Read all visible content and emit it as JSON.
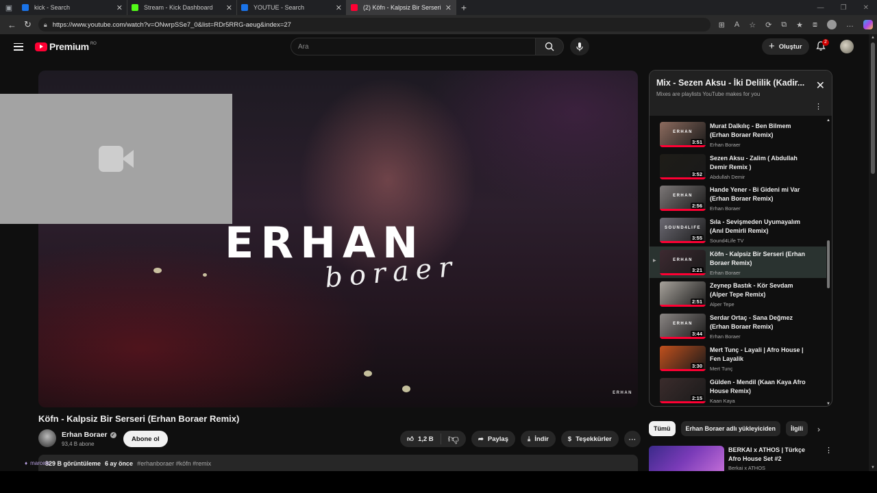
{
  "browser": {
    "tabs": [
      {
        "title": "kick - Search",
        "active": false,
        "favicon_color": "#1a73e8"
      },
      {
        "title": "Stream - Kick Dashboard",
        "active": false,
        "favicon_color": "#53fc18"
      },
      {
        "title": "YOUTUE - Search",
        "active": false,
        "favicon_color": "#1a73e8"
      },
      {
        "title": "(2) Köfn - Kalpsiz Bir Serseri (",
        "active": true,
        "favicon_color": "#ff0033"
      }
    ],
    "url": "https://www.youtube.com/watch?v=ONwrpSSe7_0&list=RDr5RRG-aeug&index=27"
  },
  "header": {
    "logo_text": "Premium",
    "logo_region": "RO",
    "search_placeholder": "Ara",
    "create_label": "Oluştur",
    "notification_count": "2"
  },
  "video": {
    "overlay_brand": "ERHAN",
    "overlay_script": "boraer",
    "corner_brand": "ERHAN",
    "title": "Köfn - Kalpsiz Bir Serseri (Erhan Boraer Remix)",
    "channel": "Erhan Boraer",
    "subscribers": "93,4 B abone",
    "subscribe_label": "Abone ol",
    "likes": "1,2 B",
    "share_label": "Paylaş",
    "download_label": "İndir",
    "thanks_label": "Teşekkürler",
    "views": "829 B görüntüleme",
    "age": "6 ay önce",
    "tags": "#erhanboraer #köfn #remix",
    "overlay_user": "marcelo"
  },
  "playlist": {
    "title": "Mix - Sezen Aksu - İki Delilik (Kadir...",
    "subtitle": "Mixes are playlists YouTube makes for you",
    "items": [
      {
        "title": "Murat Dalkılıç - Ben Bilmem (Erhan Boraer Remix)",
        "channel": "Erhan Boraer",
        "duration": "3:51",
        "label": "ERHAN",
        "color": "#8c6b5e",
        "current": false
      },
      {
        "title": "Sezen Aksu - Zalim ( Abdullah Demir Remix )",
        "channel": "Abdullah Demir",
        "duration": "3:52",
        "label": "",
        "color": "#1e1c17",
        "current": false
      },
      {
        "title": "Hande Yener - Bi Gideni mi Var (Erhan Boraer Remix)",
        "channel": "Erhan Boraer",
        "duration": "2:56",
        "label": "ERHAN",
        "color": "#7c7777",
        "current": false
      },
      {
        "title": "Sıla - Sevişmeden Uyumayalım (Anıl Demirli Remix)",
        "channel": "Sound4Life TV",
        "duration": "3:55",
        "label": "SOUND4LIFE",
        "color": "#6c6a73",
        "current": false
      },
      {
        "title": "Köfn - Kalpsiz Bir Serseri (Erhan Boraer Remix)",
        "channel": "Erhan Boraer",
        "duration": "3:21",
        "label": "ERHAN",
        "color": "#3d2a31",
        "current": true
      },
      {
        "title": "Zeynep Bastık - Kör Sevdam (Alper Tepe Remix)",
        "channel": "Alper Tepe",
        "duration": "2:51",
        "label": "",
        "color": "#a7a29b",
        "current": false
      },
      {
        "title": "Serdar Ortaç - Sana Değmez (Erhan Boraer Remix)",
        "channel": "Erhan Boraer",
        "duration": "3:44",
        "label": "ERHAN",
        "color": "#8a8583",
        "current": false
      },
      {
        "title": "Mert Tunç - Layali | Afro House | Fen Layalik",
        "channel": "Mert Tunç",
        "duration": "3:30",
        "label": "",
        "color": "#c1501d",
        "current": false
      },
      {
        "title": "Gülden - Mendil (Kaan Kaya Afro House Remix)",
        "channel": "Kaan Kaya",
        "duration": "2:15",
        "label": "",
        "color": "#3b2c2c",
        "current": false
      }
    ]
  },
  "chips": [
    "Tümü",
    "Erhan Boraer adlı yükleyiciden",
    "İlgili"
  ],
  "recommended": {
    "title": "BERKAI x ATHOS | Türkçe Afro House Set #2",
    "channel": "Berkai x ATHOS"
  }
}
